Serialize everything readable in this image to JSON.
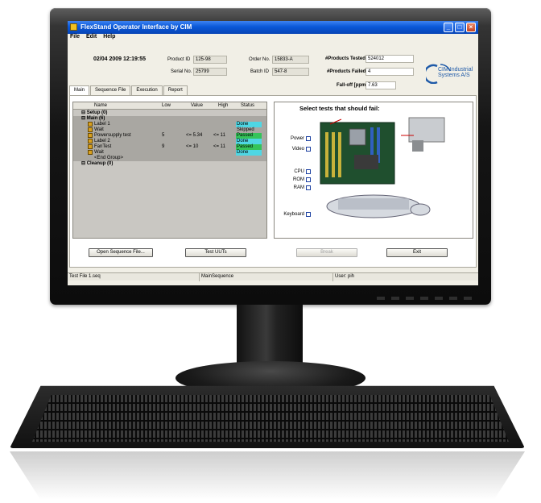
{
  "window": {
    "title": "FlexStand Operator Interface by CIM",
    "menu": [
      "File",
      "Edit",
      "Help"
    ]
  },
  "header": {
    "datetime": "02/04 2009  12:19:55",
    "product_id_label": "Product ID",
    "product_id": "125-98",
    "order_no_label": "Order No.",
    "order_no": "15833-A",
    "serial_no_label": "Serial No.",
    "serial_no": "25799",
    "batch_id_label": "Batch ID",
    "batch_id": "547-8",
    "tested_label": "#Products Tested",
    "tested": "524012",
    "failed_label": "#Products Failed",
    "failed": "4",
    "falloff_label": "Fall-off [ppm]",
    "falloff": "7.63"
  },
  "logo": {
    "line1": "CIM Industrial",
    "line2": "Systems A/S",
    "accent": "#1f5aa8"
  },
  "tabs": [
    "Main",
    "Sequence File",
    "Execution",
    "Report"
  ],
  "sequence": {
    "columns": {
      "name": "Name",
      "low": "Low",
      "value": "Value",
      "high": "High",
      "status": "Status"
    },
    "rows": [
      {
        "name": "Setup (0)",
        "low": "",
        "value": "",
        "high": "",
        "status": "",
        "kind": "group"
      },
      {
        "name": "Main (6)",
        "low": "",
        "value": "",
        "high": "",
        "status": "",
        "kind": "group"
      },
      {
        "name": "Label 1",
        "low": "",
        "value": "",
        "high": "",
        "status": "Done",
        "kind": "step"
      },
      {
        "name": "Wait",
        "low": "",
        "value": "",
        "high": "",
        "status": "Skipped",
        "kind": "step"
      },
      {
        "name": "Powersupply test",
        "low": "5",
        "value": "<= 5.34",
        "high": "<= 11",
        "status": "Passed",
        "kind": "step"
      },
      {
        "name": "Label 2",
        "low": "",
        "value": "",
        "high": "",
        "status": "Done",
        "kind": "step"
      },
      {
        "name": "FanTest",
        "low": "9",
        "value": "<= 10",
        "high": "<= 11",
        "status": "Passed",
        "kind": "step"
      },
      {
        "name": "Wait",
        "low": "",
        "value": "",
        "high": "",
        "status": "Done",
        "kind": "step"
      },
      {
        "name": "<End Group>",
        "low": "",
        "value": "",
        "high": "",
        "status": "",
        "kind": "end"
      },
      {
        "name": "Cleanup (0)",
        "low": "",
        "value": "",
        "high": "",
        "status": "",
        "kind": "group"
      }
    ]
  },
  "hardware": {
    "title": "Select tests that should fail:",
    "checkboxes": {
      "power": "Power",
      "video": "Video",
      "cpu": "CPU",
      "rom": "ROM",
      "ram": "RAM",
      "keyboard": "Keyboard"
    }
  },
  "buttons": {
    "open_sequence": "Open Sequence File...",
    "test_uuts": "Test UUTs",
    "break": "Break",
    "exit": "Exit"
  },
  "statusbar": {
    "file": "Test File 1.seq",
    "sequence": "MainSequence",
    "user": "User: pih"
  },
  "colors": {
    "done": "#4fd7e4",
    "passed": "#35c45a",
    "titlebar": "#0a58d8"
  }
}
